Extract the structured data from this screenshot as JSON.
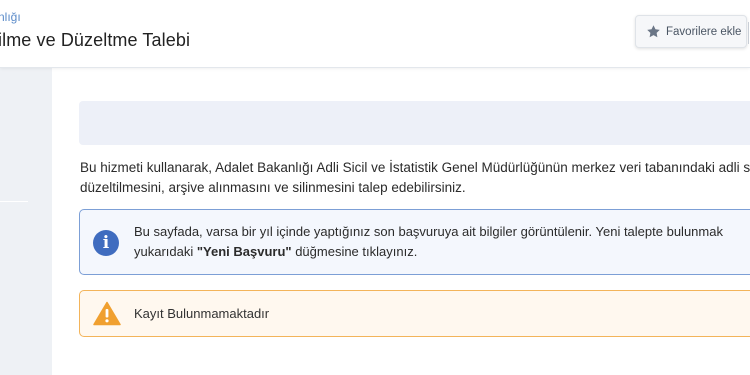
{
  "header": {
    "breadcrumb": "nlığı",
    "title": "ilme ve Düzeltme Talebi",
    "favorite_label": "Favorilere ekle"
  },
  "main": {
    "description_line1": "Bu hizmeti kullanarak, Adalet Bakanlığı Adli Sicil ve İstatistik Genel Müdürlüğünün merkez veri tabanındaki adli s",
    "description_line2": "düzeltilmesini, arşive alınmasını ve silinmesini talep edebilirsiniz.",
    "info": {
      "line1": "Bu sayfada, varsa bir yıl içinde yaptığınız son başvuruya ait bilgiler görüntülenir. Yeni talepte bulunmak",
      "line2_before": "yukarıdaki ",
      "line2_bold": "\"Yeni Başvuru\"",
      "line2_after": " düğmesine tıklayınız.",
      "icon": "info-icon"
    },
    "warning": {
      "text": "Kayıt Bulunmamaktadır",
      "icon": "warning-icon"
    }
  },
  "colors": {
    "info_accent": "#3f6cbf",
    "warning_accent": "#f0a030",
    "breadcrumb": "#5b8bc9"
  }
}
